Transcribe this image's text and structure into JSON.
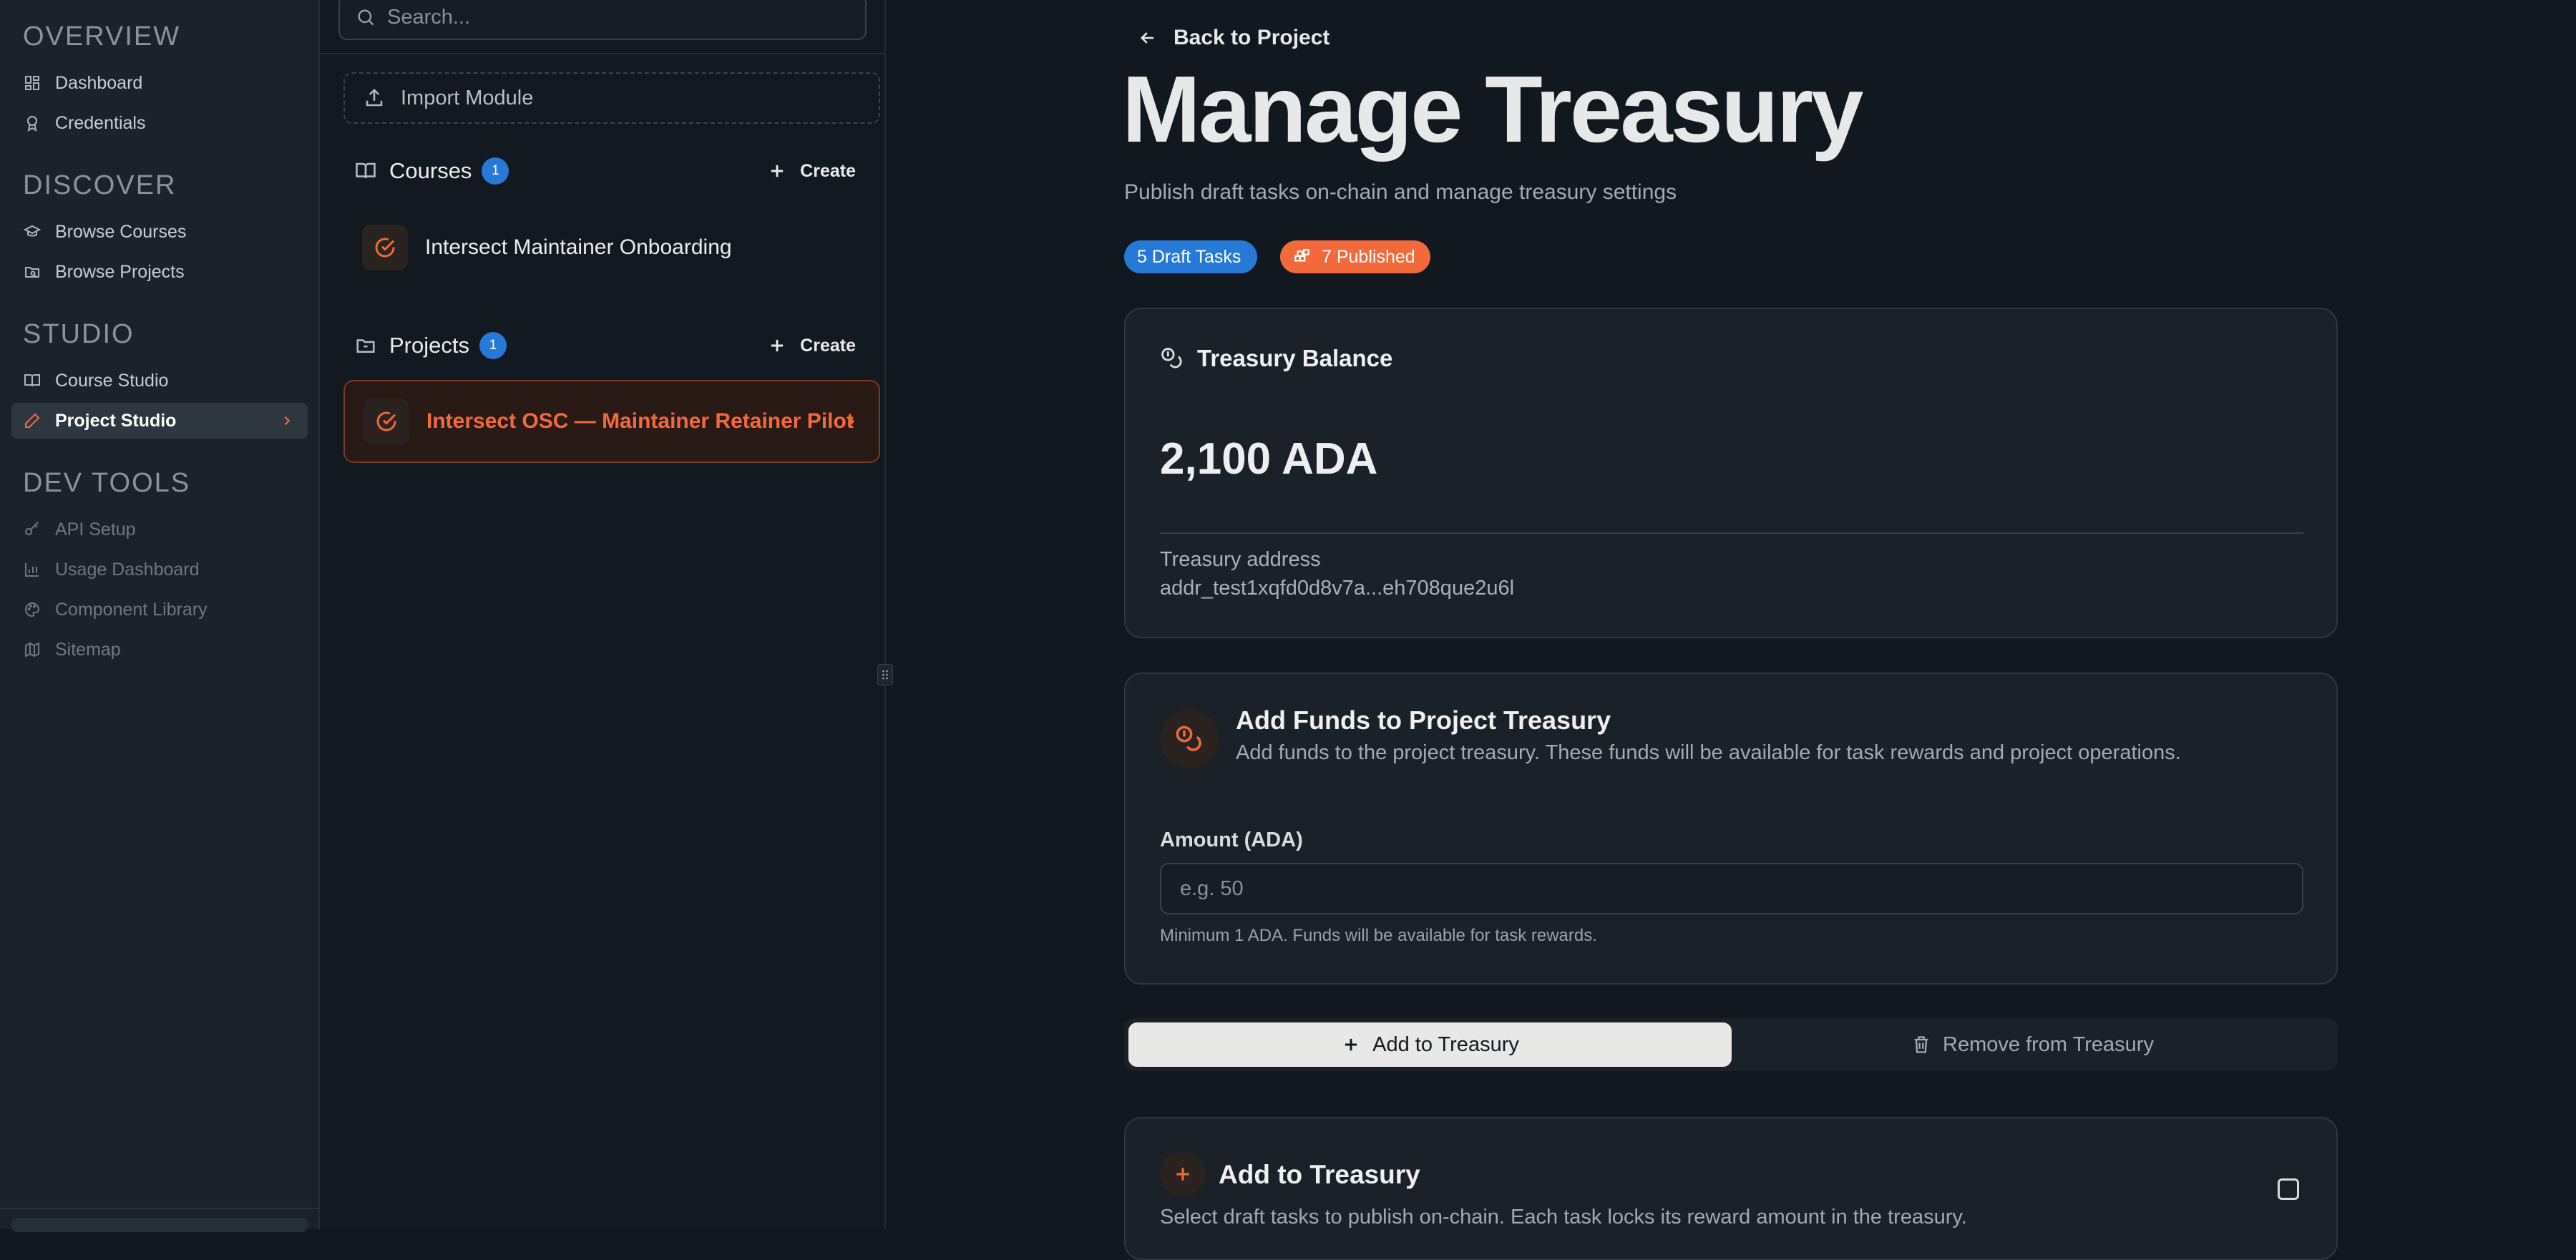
{
  "sidebar": {
    "sections": [
      {
        "title": "OVERVIEW",
        "items": [
          {
            "label": "Dashboard",
            "icon": "dashboard-icon"
          },
          {
            "label": "Credentials",
            "icon": "award-icon"
          }
        ]
      },
      {
        "title": "DISCOVER",
        "items": [
          {
            "label": "Browse Courses",
            "icon": "graduation-cap-icon"
          },
          {
            "label": "Browse Projects",
            "icon": "folder-search-icon"
          }
        ]
      },
      {
        "title": "STUDIO",
        "items": [
          {
            "label": "Course Studio",
            "icon": "book-open-icon"
          },
          {
            "label": "Project Studio",
            "icon": "pencil-icon",
            "active": true
          }
        ]
      },
      {
        "title": "DEV TOOLS",
        "items": [
          {
            "label": "API Setup",
            "icon": "key-icon"
          },
          {
            "label": "Usage Dashboard",
            "icon": "bar-chart-icon"
          },
          {
            "label": "Component Library",
            "icon": "palette-icon"
          },
          {
            "label": "Sitemap",
            "icon": "map-icon"
          }
        ]
      }
    ]
  },
  "studio_panel": {
    "search_placeholder": "Search...",
    "import_label": "Import Module",
    "courses": {
      "title": "Courses",
      "count": "1",
      "create_label": "Create",
      "items": [
        {
          "label": "Intersect Maintainer Onboarding"
        }
      ]
    },
    "projects": {
      "title": "Projects",
      "count": "1",
      "create_label": "Create",
      "items": [
        {
          "label": "Intersect OSC — Maintainer Retainer Pilot",
          "selected": true
        }
      ]
    }
  },
  "main": {
    "back_label": "Back to Project",
    "title": "Manage Treasury",
    "subtitle": "Publish draft tasks on-chain and manage treasury settings",
    "badges": {
      "draft": "5 Draft Tasks",
      "published": "7 Published"
    },
    "balance": {
      "title": "Treasury Balance",
      "amount": "2,100 ADA",
      "address_label": "Treasury address",
      "address": "addr_test1xqfd0d8v7a...eh708que2u6l"
    },
    "add_funds": {
      "title": "Add Funds to Project Treasury",
      "description": "Add funds to the project treasury. These funds will be available for task rewards and project operations.",
      "amount_label": "Amount (ADA)",
      "amount_placeholder": "e.g. 50",
      "help": "Minimum 1 ADA. Funds will be available for task rewards."
    },
    "segmented": {
      "add_label": "Add to Treasury",
      "remove_label": "Remove from Treasury",
      "selected": "add"
    },
    "add_section": {
      "title": "Add to Treasury",
      "description": "Select draft tasks to publish on-chain. Each task locks its reward amount in the treasury."
    }
  },
  "colors": {
    "accent": "#f26a3b",
    "badge_blue": "#2779d8",
    "background": "#111820",
    "card": "#1b2129"
  }
}
